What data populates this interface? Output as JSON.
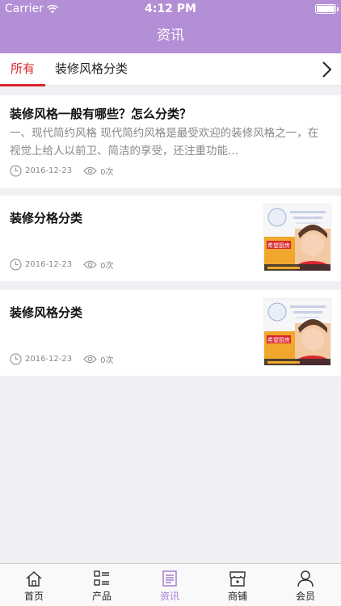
{
  "status_bar": {
    "carrier": "Carrier",
    "time": "4:12 PM"
  },
  "nav": {
    "title": "资讯"
  },
  "tabs": [
    {
      "label": "所有",
      "active": true
    },
    {
      "label": "装修风格分类",
      "active": false
    }
  ],
  "articles": [
    {
      "title": "装修风格一般有哪些？怎么分类？",
      "summary": "一、现代简约风格 现代简约风格是最受欢迎的装修风格之一，在视觉上给人以前卫、简洁的享受，还注重功能...",
      "date": "2016-12-23",
      "views": "0次"
    },
    {
      "title": "装修分格分类",
      "date": "2016-12-23",
      "views": "0次",
      "thumb_text": "希望厨房"
    },
    {
      "title": "装修风格分类",
      "date": "2016-12-23",
      "views": "0次",
      "thumb_text": "希望厨房"
    }
  ],
  "bottom_tabs": [
    {
      "label": "首页",
      "icon": "home-icon"
    },
    {
      "label": "产品",
      "icon": "grid-list-icon"
    },
    {
      "label": "资讯",
      "icon": "news-icon",
      "active": true
    },
    {
      "label": "商铺",
      "icon": "store-icon"
    },
    {
      "label": "会员",
      "icon": "user-icon"
    }
  ],
  "colors": {
    "accent": "#b38fd6",
    "active_tab": "#d9262e",
    "bottom_active": "#a97bd4",
    "background": "#efeff4"
  }
}
